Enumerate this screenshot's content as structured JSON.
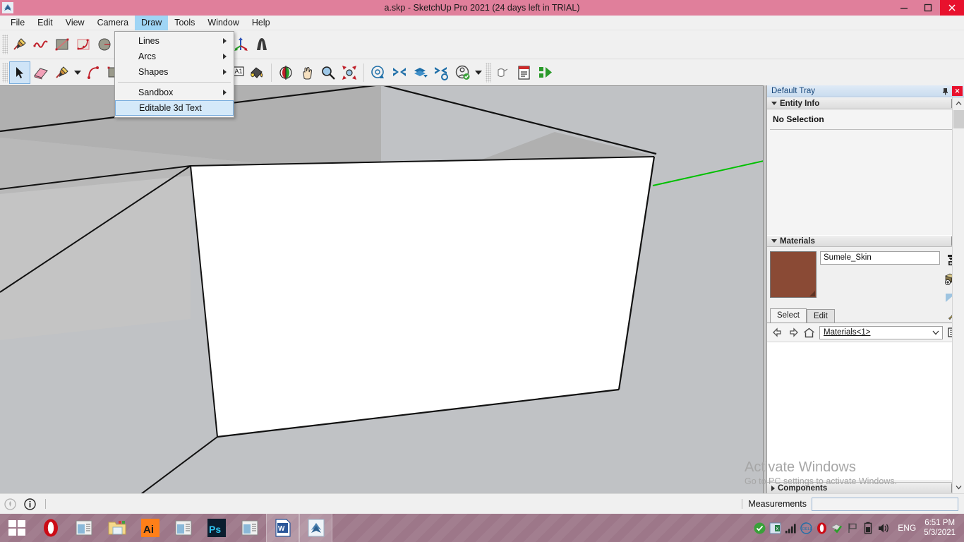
{
  "titlebar": {
    "title": "a.skp - SketchUp Pro 2021 (24 days left in TRIAL)",
    "app_icon": "sketchup-logo-icon",
    "minimize_label": "—",
    "maximize_label": "❐",
    "close_label": "✕"
  },
  "menubar": {
    "items": [
      {
        "label": "File"
      },
      {
        "label": "Edit"
      },
      {
        "label": "View"
      },
      {
        "label": "Camera"
      },
      {
        "label": "Draw"
      },
      {
        "label": "Tools"
      },
      {
        "label": "Window"
      },
      {
        "label": "Help"
      }
    ],
    "active_index": 4
  },
  "draw_menu": {
    "items": [
      {
        "label": "Lines",
        "has_submenu": true
      },
      {
        "label": "Arcs",
        "has_submenu": true
      },
      {
        "label": "Shapes",
        "has_submenu": true
      },
      {
        "separator": true
      },
      {
        "label": "Sandbox",
        "has_submenu": true
      },
      {
        "label": "Editable 3d Text",
        "has_submenu": false,
        "highlighted": true
      }
    ]
  },
  "toolbars": {
    "row1": [
      {
        "name": "line-tool-icon",
        "title": "Line"
      },
      {
        "name": "freehand-tool-icon",
        "title": "Freehand"
      },
      {
        "name": "rectangle-tool-icon",
        "title": "Rectangle"
      },
      {
        "name": "arc-tool-icon",
        "title": "Arc"
      },
      {
        "name": "circle-tool-icon",
        "title": "Circle"
      },
      {
        "name": "polygon-tool-icon",
        "title": "Polygon"
      },
      {
        "name": "tape-measure-tool-icon",
        "title": "Tape Measure"
      },
      {
        "name": "dimension-tool-icon",
        "title": "Dimension"
      },
      {
        "name": "protractor-tool-icon",
        "title": "Protractor"
      },
      {
        "name": "text-tool-icon",
        "title": "Text",
        "glyph": "A1"
      },
      {
        "name": "axes-tool-icon",
        "title": "Axes"
      },
      {
        "name": "3d-text-tool-icon",
        "title": "3D Text"
      }
    ],
    "row2": [
      {
        "name": "select-tool-icon",
        "title": "Select",
        "selected": true
      },
      {
        "name": "eraser-tool-icon",
        "title": "Eraser"
      },
      {
        "name": "line-tool-icon",
        "title": "Line"
      },
      {
        "name": "line-tool-dropdown-caret",
        "title": "Line options"
      },
      {
        "name": "arc-tool-icon",
        "title": "Arc"
      },
      {
        "name": "shapes-tool-icon",
        "title": "Shapes"
      },
      {
        "name": "move-tool-icon",
        "title": "Move"
      },
      {
        "name": "rotate-tool-icon",
        "title": "Rotate"
      },
      {
        "name": "push-pull-tool-icon",
        "title": "Push/Pull"
      },
      {
        "name": "tape-measure-tool-icon",
        "title": "Tape Measure"
      },
      {
        "name": "text-tool-icon",
        "title": "Text",
        "glyph": "A1"
      },
      {
        "name": "paint-bucket-tool-icon",
        "title": "Paint Bucket"
      },
      {
        "name": "orbit-tool-icon",
        "title": "Orbit"
      },
      {
        "name": "pan-tool-icon",
        "title": "Pan"
      },
      {
        "name": "zoom-tool-icon",
        "title": "Zoom"
      },
      {
        "name": "zoom-extents-tool-icon",
        "title": "Zoom Extents"
      },
      {
        "name": "3d-warehouse-icon",
        "title": "3D Warehouse"
      },
      {
        "name": "extension-warehouse-icon",
        "title": "Extension Warehouse"
      },
      {
        "name": "add-location-icon",
        "title": "Add Location"
      },
      {
        "name": "extension-manager-icon",
        "title": "Extension Manager"
      },
      {
        "name": "user-account-icon",
        "title": "Account"
      },
      {
        "name": "account-dropdown-caret",
        "title": "Account menu"
      },
      {
        "name": "interact-tool-icon",
        "title": "Interact"
      },
      {
        "name": "report-icon",
        "title": "Generate Report"
      },
      {
        "name": "export-icon",
        "title": "Export"
      }
    ]
  },
  "viewport": {
    "background_color": "#c0c2c5",
    "face_white_color": "#ffffff",
    "face_top_color": "#b0b0b0",
    "face_left_color": "#c4c4c4",
    "ground_color": "#c0c2c5",
    "green_axis_color": "#00c000",
    "edge_color": "#000000"
  },
  "tray": {
    "title": "Default Tray",
    "pin_icon": "pin-icon",
    "close_label": "✕",
    "entity_info": {
      "title": "Entity Info",
      "close_label": "✕",
      "status": "No Selection"
    },
    "materials": {
      "title": "Materials",
      "close_label": "✕",
      "material_name": "Sumele_Skin",
      "swatch_color": "#8a4a35",
      "side_icons": [
        {
          "name": "create-material-icon"
        },
        {
          "name": "add-to-model-icon"
        },
        {
          "name": "display-swatch-icon"
        }
      ],
      "tabs": [
        {
          "label": "Select",
          "active": true
        },
        {
          "label": "Edit",
          "active": false
        }
      ],
      "eyedropper_icon": "eyedropper-icon",
      "nav": {
        "back_icon": "arrow-left-icon",
        "forward_icon": "arrow-right-icon",
        "home_icon": "home-icon",
        "library": "Materials<1>",
        "caret": "⌄",
        "details_icon": "details-menu-icon"
      }
    },
    "components": {
      "title": "Components",
      "collapsed": true
    },
    "scrollbar": {
      "up_icon": "chevron-up-icon",
      "down_icon": "chevron-down-icon"
    }
  },
  "statusbar": {
    "icons": [
      {
        "name": "geo-location-icon"
      },
      {
        "name": "info-icon"
      }
    ],
    "measurements_label": "Measurements",
    "measurements_value": "",
    "measurements_placeholder": ""
  },
  "watermark": {
    "line1": "Activate Windows",
    "line2": "Go to PC settings to activate Windows."
  },
  "taskbar": {
    "start_icon": "windows-start-icon",
    "items": [
      {
        "name": "opera-icon",
        "label": "Opera",
        "active": false
      },
      {
        "name": "app-window-icon",
        "label": "App",
        "active": false
      },
      {
        "name": "file-explorer-icon",
        "label": "File Explorer",
        "active": false
      },
      {
        "name": "illustrator-icon",
        "label": "Ai",
        "active": false
      },
      {
        "name": "app-window-icon",
        "label": "App",
        "active": false
      },
      {
        "name": "photoshop-icon",
        "label": "Ps",
        "active": false
      },
      {
        "name": "app-window-icon",
        "label": "App",
        "active": false
      },
      {
        "name": "word-icon",
        "label": "W",
        "active": true
      },
      {
        "name": "sketchup-icon",
        "label": "SketchUp",
        "active": true
      }
    ],
    "tray_icons": [
      {
        "name": "check-green-icon"
      },
      {
        "name": "excel-tray-icon"
      },
      {
        "name": "signal-bars-icon"
      },
      {
        "name": "dell-icon"
      },
      {
        "name": "opera-tray-icon"
      },
      {
        "name": "safe-check-icon"
      },
      {
        "name": "flag-icon"
      },
      {
        "name": "battery-icon"
      },
      {
        "name": "volume-icon"
      }
    ],
    "language": "ENG",
    "time": "6:51 PM",
    "date": "5/3/2021"
  }
}
